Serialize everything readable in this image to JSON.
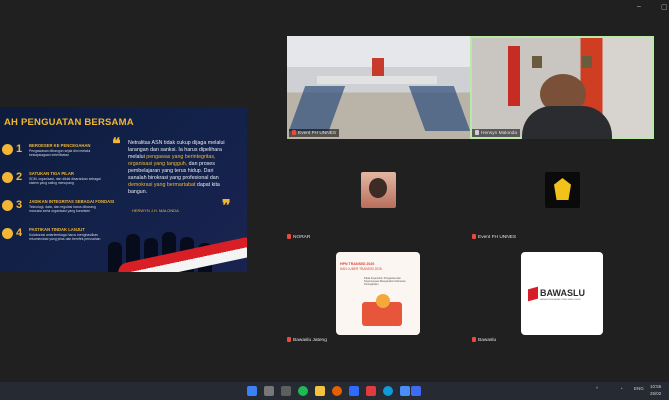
{
  "window": {
    "close_label": "×",
    "maximize_label": "▢",
    "minimize_label": "–"
  },
  "slide": {
    "title": "AH PENGUATAN BERSAMA",
    "steps": [
      {
        "num": "1",
        "head": "BEROESER KE PENCEGAHAN",
        "body": "Pengawasan dibangun sejak dini melalui kesiapsiagaan keterlibatan"
      },
      {
        "num": "2",
        "head": "SATUKAN TIGA PILAR",
        "body": "SDM, organisasi, dan diklat disarankan sebagai sistem yang saling menopang"
      },
      {
        "num": "3",
        "head": "JADIKAN INTEGRITAS SEBAGAI FONDASI",
        "body": "Teknologi, data, dan regulasi harus dibarang manusia serta organisasi yang konsisten"
      },
      {
        "num": "4",
        "head": "PASTIKAN TINDAK LANJUT",
        "body": "Kolaborasi antarlembaga harus menghasilkan rekomendasi yang jelas dan berefek perusahan"
      }
    ],
    "quote_open": "❝",
    "quote_close": "❞",
    "quote_a": "Netralitas ASN tidak cukup dijaga melalui larangan dan sanksi. Ia harus dipelihara melalui ",
    "quote_hl1": "pengawas yang berintegritas, organisasi yang tangguh,",
    "quote_b": " dan proses pembelajaran yang terus hidup. Dari sanalah birokrasi yang profesional dan ",
    "quote_hl2": "demokrasi yang bermartabat",
    "quote_c": " dapat kita bangun.",
    "author": "HERWYN J.H. MALONDA"
  },
  "participants": [
    {
      "name": "Event FH UNNES",
      "kind": "video-room"
    },
    {
      "name": "Herwyn Malonda",
      "kind": "video-speaker"
    },
    {
      "name": "NORAR",
      "kind": "avatar-photo"
    },
    {
      "name": "Event FH UNNES",
      "kind": "avatar-logo"
    },
    {
      "name": "Bawaslu Jateng",
      "kind": "avatar-poster"
    },
    {
      "name": "Bawaslu",
      "kind": "avatar-logo-bawaslu"
    }
  ],
  "poster": {
    "title1": "HPN TRANSISI 2026",
    "title2": "DAN LUBER TRANSISI 2026",
    "caption": "Pada Kepemilun Pengawas dan Kepercayaan Masyarakat Indonesia Peningkatan"
  },
  "bawaslu": {
    "word": "BAWASLU",
    "sub": "BADAN PENGAWAS PEMILIHAN UMUM"
  },
  "tray": {
    "lang": "ENG",
    "time": "10:55",
    "date": "25/02"
  },
  "colors": {
    "accent": "#f2b632",
    "slide_bg": "#0d1b3d",
    "bawaslu_red": "#d71e28"
  }
}
